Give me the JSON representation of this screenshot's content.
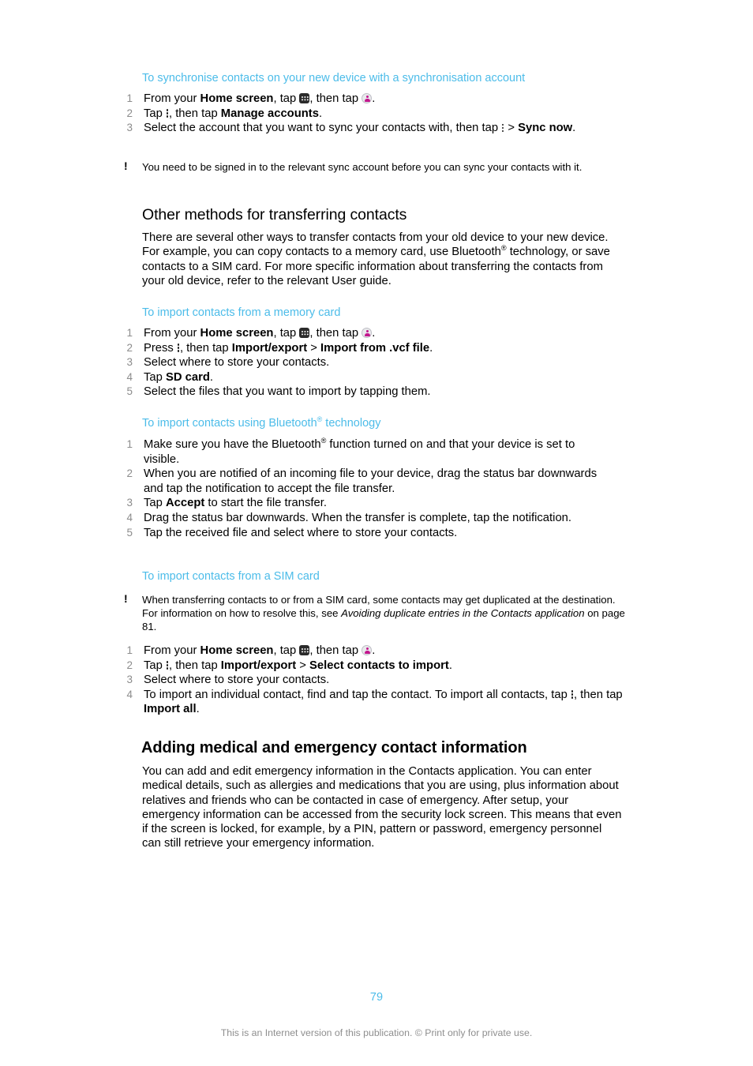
{
  "document": {
    "page_number": "79",
    "footer_note": "This is an Internet version of this publication. © Print only for private use.",
    "accent_color": "#4cbce9",
    "icon_contact_color": "#c2168d"
  },
  "sync_section": {
    "heading": "To synchronise contacts on your new device with a synchronisation account",
    "steps": [
      {
        "num": "1",
        "parts": [
          {
            "t": "From your ",
            "s": "n"
          },
          {
            "t": "Home screen",
            "s": "b"
          },
          {
            "t": ", tap ",
            "s": "n"
          },
          {
            "t": "apps-drawer-icon",
            "s": "icon-apps"
          },
          {
            "t": ", then tap ",
            "s": "n"
          },
          {
            "t": "contacts-icon",
            "s": "icon-contact"
          },
          {
            "t": ".",
            "s": "n"
          }
        ]
      },
      {
        "num": "2",
        "parts": [
          {
            "t": "Tap ",
            "s": "n"
          },
          {
            "t": "overflow-menu-icon",
            "s": "icon-menu"
          },
          {
            "t": ", then tap ",
            "s": "n"
          },
          {
            "t": "Manage accounts",
            "s": "b"
          },
          {
            "t": ".",
            "s": "n"
          }
        ]
      },
      {
        "num": "3",
        "parts": [
          {
            "t": "Select the account that you want to sync your contacts with, then tap ",
            "s": "n"
          },
          {
            "t": "overflow-menu-icon",
            "s": "icon-menu"
          },
          {
            "t": " > ",
            "s": "n"
          },
          {
            "t": "Sync now",
            "s": "b"
          },
          {
            "t": ".",
            "s": "n"
          }
        ]
      }
    ],
    "note": "You need to be signed in to the relevant sync account before you can sync your contacts with it.",
    "note_marker": "!"
  },
  "other_methods": {
    "heading": "Other methods for transferring contacts",
    "paragraph_parts": [
      {
        "t": "There are several other ways to transfer contacts from your old device to your new device. For example, you can copy contacts to a memory card, use Bluetooth",
        "s": "n"
      },
      {
        "t": "®",
        "s": "sup"
      },
      {
        "t": " technology, or save contacts to a SIM card. For more specific information about transferring the contacts from your old device, refer to the relevant User guide.",
        "s": "n"
      }
    ]
  },
  "memory_card": {
    "heading": "To import contacts from a memory card",
    "steps": [
      {
        "num": "1",
        "parts": [
          {
            "t": "From your ",
            "s": "n"
          },
          {
            "t": "Home screen",
            "s": "b"
          },
          {
            "t": ", tap ",
            "s": "n"
          },
          {
            "t": "apps-drawer-icon",
            "s": "icon-apps"
          },
          {
            "t": ", then tap ",
            "s": "n"
          },
          {
            "t": "contacts-icon",
            "s": "icon-contact"
          },
          {
            "t": ".",
            "s": "n"
          }
        ]
      },
      {
        "num": "2",
        "parts": [
          {
            "t": "Press ",
            "s": "n"
          },
          {
            "t": "overflow-menu-icon",
            "s": "icon-menu"
          },
          {
            "t": ", then tap ",
            "s": "n"
          },
          {
            "t": "Import/export",
            "s": "b"
          },
          {
            "t": " > ",
            "s": "n"
          },
          {
            "t": "Import from .vcf file",
            "s": "b"
          },
          {
            "t": ".",
            "s": "n"
          }
        ]
      },
      {
        "num": "3",
        "parts": [
          {
            "t": "Select where to store your contacts.",
            "s": "n"
          }
        ]
      },
      {
        "num": "4",
        "parts": [
          {
            "t": "Tap ",
            "s": "n"
          },
          {
            "t": "SD card",
            "s": "b"
          },
          {
            "t": ".",
            "s": "n"
          }
        ]
      },
      {
        "num": "5",
        "parts": [
          {
            "t": "Select the files that you want to import by tapping them.",
            "s": "n"
          }
        ]
      }
    ]
  },
  "bluetooth": {
    "heading_parts": [
      {
        "t": "To import contacts using Bluetooth",
        "s": "n"
      },
      {
        "t": "®",
        "s": "sup"
      },
      {
        "t": " technology",
        "s": "n"
      }
    ],
    "steps": [
      {
        "num": "1",
        "parts": [
          {
            "t": "Make sure you have the Bluetooth",
            "s": "n"
          },
          {
            "t": "®",
            "s": "sup"
          },
          {
            "t": " function turned on and that your device is set to visible.",
            "s": "n"
          }
        ]
      },
      {
        "num": "2",
        "parts": [
          {
            "t": "When you are notified of an incoming file to your device, drag the status bar downwards and tap the notification to accept the file transfer.",
            "s": "n"
          }
        ]
      },
      {
        "num": "3",
        "parts": [
          {
            "t": "Tap ",
            "s": "n"
          },
          {
            "t": "Accept",
            "s": "b"
          },
          {
            "t": " to start the file transfer.",
            "s": "n"
          }
        ]
      },
      {
        "num": "4",
        "parts": [
          {
            "t": "Drag the status bar downwards. When the transfer is complete, tap the notification.",
            "s": "n"
          }
        ]
      },
      {
        "num": "5",
        "parts": [
          {
            "t": "Tap the received file and select where to store your contacts.",
            "s": "n"
          }
        ]
      }
    ]
  },
  "sim_card": {
    "heading": "To import contacts from a SIM card",
    "note_marker": "!",
    "note_parts": [
      {
        "t": "When transferring contacts to or from a SIM card, some contacts may get duplicated at the destination. For information on how to resolve this, see ",
        "s": "n"
      },
      {
        "t": "Avoiding duplicate entries in the Contacts application",
        "s": "i"
      },
      {
        "t": " on page 81.",
        "s": "n"
      }
    ],
    "steps": [
      {
        "num": "1",
        "parts": [
          {
            "t": "From your ",
            "s": "n"
          },
          {
            "t": "Home screen",
            "s": "b"
          },
          {
            "t": ", tap ",
            "s": "n"
          },
          {
            "t": "apps-drawer-icon",
            "s": "icon-apps"
          },
          {
            "t": ", then tap ",
            "s": "n"
          },
          {
            "t": "contacts-icon",
            "s": "icon-contact"
          },
          {
            "t": ".",
            "s": "n"
          }
        ]
      },
      {
        "num": "2",
        "parts": [
          {
            "t": "Tap ",
            "s": "n"
          },
          {
            "t": "overflow-menu-icon",
            "s": "icon-menu"
          },
          {
            "t": ", then tap ",
            "s": "n"
          },
          {
            "t": "Import/export",
            "s": "b"
          },
          {
            "t": " > ",
            "s": "n"
          },
          {
            "t": "Select contacts to import",
            "s": "b"
          },
          {
            "t": ".",
            "s": "n"
          }
        ]
      },
      {
        "num": "3",
        "parts": [
          {
            "t": "Select where to store your contacts.",
            "s": "n"
          }
        ]
      },
      {
        "num": "4",
        "parts": [
          {
            "t": "To import an individual contact, find and tap the contact. To import all contacts, tap ",
            "s": "n"
          },
          {
            "t": "overflow-menu-icon",
            "s": "icon-menu"
          },
          {
            "t": ", then tap ",
            "s": "n"
          },
          {
            "t": "Import all",
            "s": "b"
          },
          {
            "t": ".",
            "s": "n"
          }
        ]
      }
    ]
  },
  "medical": {
    "heading": "Adding medical and emergency contact information",
    "paragraph": "You can add and edit emergency information in the Contacts application. You can enter medical details, such as allergies and medications that you are using, plus information about relatives and friends who can be contacted in case of emergency. After setup, your emergency information can be accessed from the security lock screen. This means that even if the screen is locked, for example, by a PIN, pattern or password, emergency personnel can still retrieve your emergency information."
  }
}
